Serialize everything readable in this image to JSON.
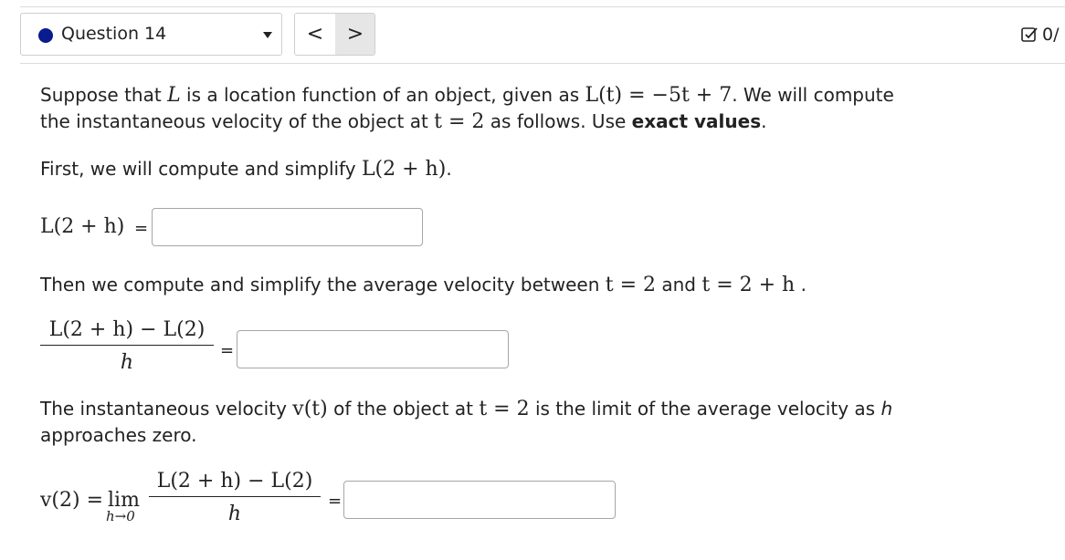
{
  "header": {
    "question_label": "Question 14",
    "prev_label": "<",
    "next_label": ">",
    "score": "0/"
  },
  "problem": {
    "p1a": "Suppose that ",
    "p1_L": "L",
    "p1b": " is a location function of an object, given as ",
    "p1_func": "L(t) = −5t + 7",
    "p1c": ". We will compute",
    "p2a": "the instantaneous velocity of the object at ",
    "p2_t": "t = 2",
    "p2b": " as follows. Use ",
    "p2_bold": "exact values",
    "p2c": ".",
    "p3a": "First, we will compute and simplify ",
    "p3_expr": "L(2 + h)",
    "p3b": ".",
    "lbl1_expr": "L(2 + h)",
    "equals": "=",
    "p4a": "Then we compute and simplify the average velocity between ",
    "p4_t1": "t = 2",
    "p4_and": " and ",
    "p4_t2": "t = 2 + h",
    "p4b": " .",
    "frac_num": "L(2 + h) − L(2)",
    "frac_den": "h",
    "p5a": "The instantaneous velocity ",
    "p5_v": "v(t)",
    "p5b": " of the object at ",
    "p5_t": "t = 2",
    "p5c": " is the limit of the average velocity as ",
    "p5_h": "h",
    "p6": "approaches zero.",
    "v2": "v(2) =",
    "lim": "lim",
    "lim_sub": "h→0"
  },
  "answers": [
    "",
    "",
    ""
  ]
}
